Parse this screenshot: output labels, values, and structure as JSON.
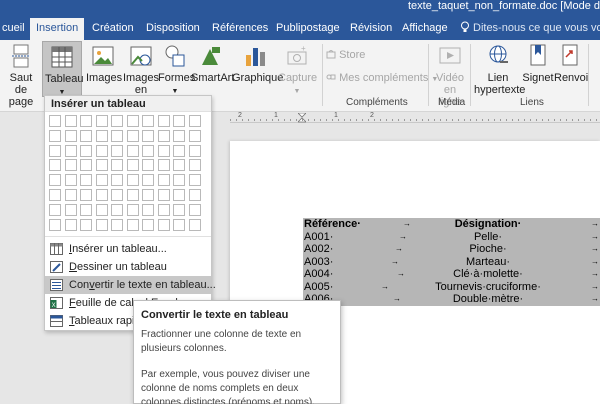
{
  "title_bar": {
    "text": "texte_taquet_non_formate.doc [Mode de comp"
  },
  "tabs": [
    {
      "label": "cueil"
    },
    {
      "label": "Insertion"
    },
    {
      "label": "Création"
    },
    {
      "label": "Disposition"
    },
    {
      "label": "Références"
    },
    {
      "label": "Publipostage"
    },
    {
      "label": "Révision"
    },
    {
      "label": "Affichage"
    }
  ],
  "tell_me": {
    "placeholder": "Dites-nous ce que vous voulez"
  },
  "ribbon": {
    "saut_de_page": {
      "line1": "Saut de",
      "line2": "page"
    },
    "tableau": {
      "label": "Tableau"
    },
    "images": {
      "label": "Images"
    },
    "images_en_ligne": {
      "line1": "Images",
      "line2": "en ligne"
    },
    "formes": {
      "label": "Formes"
    },
    "smartart": {
      "label": "SmartArt"
    },
    "graphique": {
      "label": "Graphique"
    },
    "capture": {
      "label": "Capture"
    },
    "store": {
      "label": "Store"
    },
    "mes_complements": {
      "label": "Mes compléments"
    },
    "complements_group": {
      "label": "Compléments"
    },
    "video": {
      "line1": "Vidéo",
      "line2": "en ligne"
    },
    "media_group": {
      "label": "Média"
    },
    "lien": {
      "line1": "Lien",
      "line2": "hypertexte"
    },
    "signet": {
      "label": "Signet"
    },
    "renvoi": {
      "label": "Renvoi"
    },
    "liens_group": {
      "label": "Liens"
    }
  },
  "ruler": {
    "numbers": [
      "2",
      "1",
      "1",
      "2"
    ]
  },
  "document_table": {
    "header": {
      "ref": "Référence·",
      "des": "Désignation·"
    },
    "rows": [
      {
        "ref": "A001·",
        "des": "Pelle·"
      },
      {
        "ref": "A002·",
        "des": "Pioche·"
      },
      {
        "ref": "A003·",
        "des": "Marteau·"
      },
      {
        "ref": "A004·",
        "des": "Clé·à·molette·"
      },
      {
        "ref": "A005·",
        "des": "Tournevis·cruciforme·"
      },
      {
        "ref": "A006·",
        "des": "Double·mètre·"
      }
    ],
    "tab_glyph": "→"
  },
  "dropdown": {
    "header": "Insérer un tableau",
    "grid": {
      "columns": 10,
      "rows": 8
    },
    "items": [
      {
        "pre": "",
        "key": "I",
        "post": "nsérer un tableau..."
      },
      {
        "pre": "",
        "key": "D",
        "post": "essiner un tableau"
      },
      {
        "pre": "Con",
        "key": "v",
        "post": "ertir le texte en tableau..."
      },
      {
        "pre": "",
        "key": "F",
        "post": "euille de calcul Excel"
      },
      {
        "pre": "",
        "key": "T",
        "post": "ableaux rapides"
      }
    ]
  },
  "tooltip": {
    "title": "Convertir le texte en tableau",
    "p1": "Fractionner une colonne de texte en plusieurs colonnes.",
    "p2": "Par exemple, vous pouvez diviser une colonne de noms complets en deux colonnes distinctes (prénoms et noms)."
  },
  "colors": {
    "accent": "#2b579a",
    "ribbon": "#f3f3f3",
    "table_shading": "#b6b6b6"
  }
}
